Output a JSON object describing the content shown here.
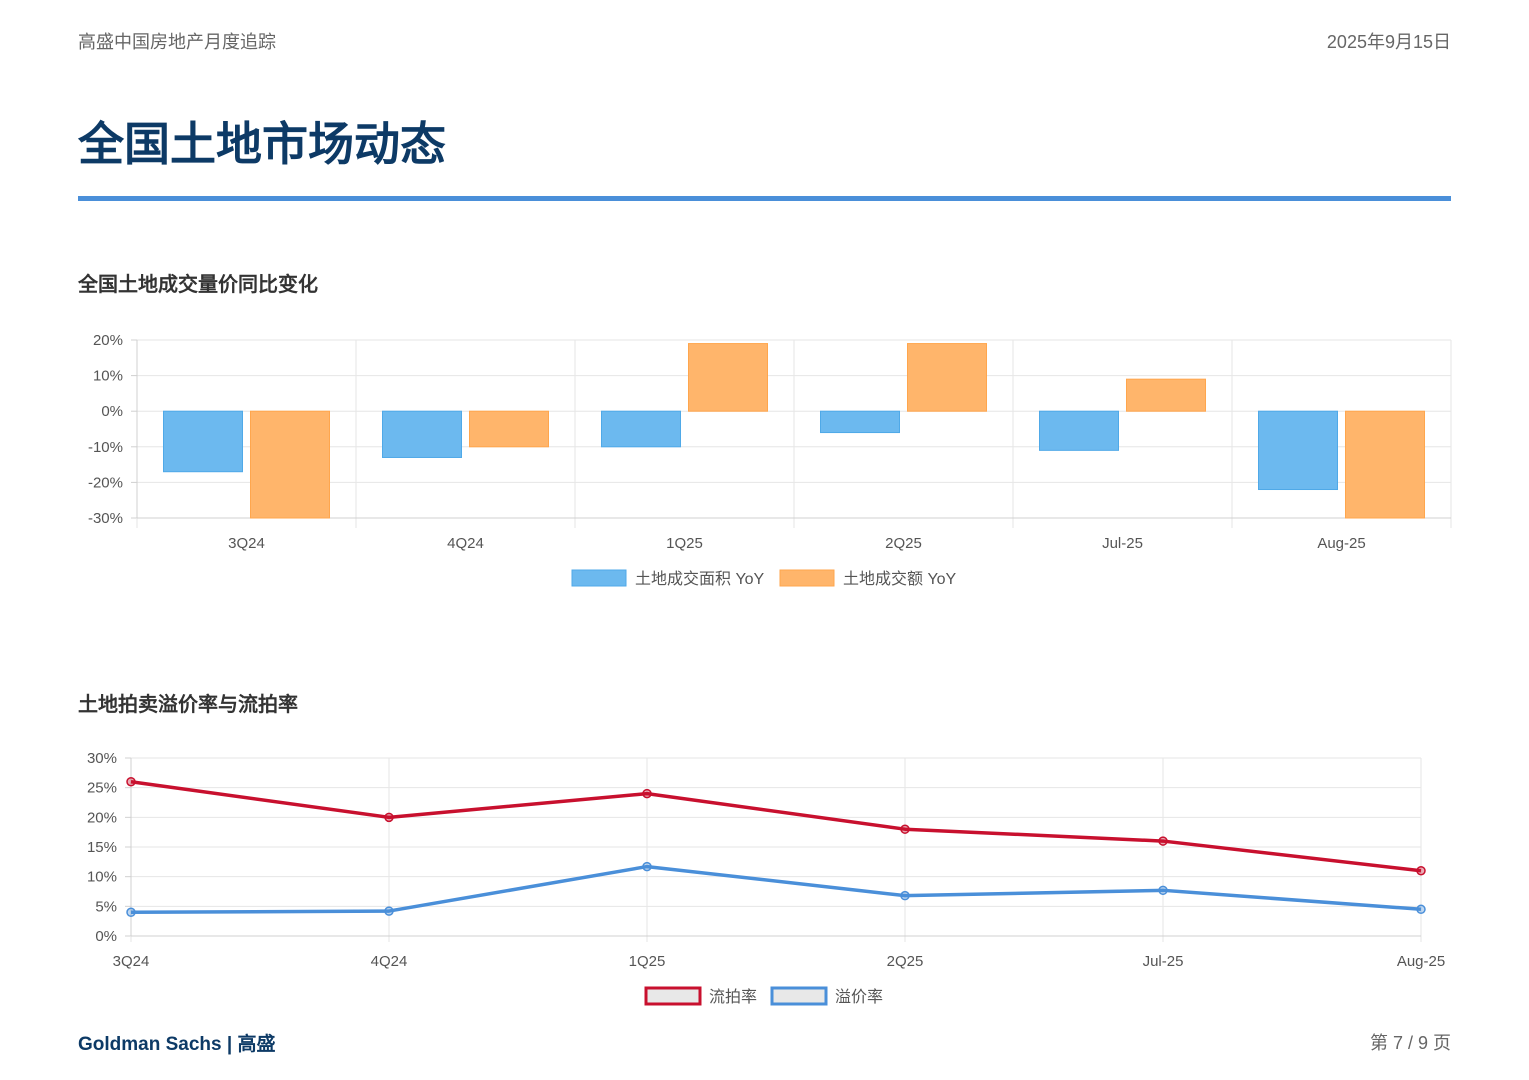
{
  "header": {
    "left": "高盛中国房地产月度追踪",
    "right": "2025年9月15日"
  },
  "page_title": "全国土地市场动态",
  "footer": {
    "left": "Goldman Sachs | 高盛",
    "right": "第 7 / 9 页"
  },
  "colors": {
    "area": "#6cb9ef",
    "value": "#ffb56b",
    "failure": "#c8102e",
    "premium": "#4a8fd9",
    "title": "#0d3a66"
  },
  "chart_data": [
    {
      "type": "bar",
      "title": "全国土地成交量价同比变化",
      "categories": [
        "3Q24",
        "4Q24",
        "1Q25",
        "2Q25",
        "Jul-25",
        "Aug-25"
      ],
      "series": [
        {
          "name": "土地成交面积 YoY",
          "values": [
            -17,
            -13,
            -10,
            -6,
            -11,
            -22
          ]
        },
        {
          "name": "土地成交额 YoY",
          "values": [
            -30,
            -10,
            19,
            19,
            9,
            -30
          ]
        }
      ],
      "ylim": [
        -30,
        20
      ],
      "yticks": [
        20,
        10,
        0,
        -10,
        -20,
        -30
      ],
      "ytick_labels": [
        "20%",
        "10%",
        "0%",
        "-10%",
        "-20%",
        "-30%"
      ],
      "grid": true,
      "legend": "bottom"
    },
    {
      "type": "line",
      "title": "土地拍卖溢价率与流拍率",
      "categories": [
        "3Q24",
        "4Q24",
        "1Q25",
        "2Q25",
        "Jul-25",
        "Aug-25"
      ],
      "series": [
        {
          "name": "流拍率",
          "values": [
            26,
            20,
            24,
            18,
            16,
            11
          ]
        },
        {
          "name": "溢价率",
          "values": [
            4.0,
            4.2,
            11.7,
            6.8,
            7.7,
            4.5
          ]
        }
      ],
      "ylim": [
        0,
        30
      ],
      "yticks": [
        30,
        25,
        20,
        15,
        10,
        5,
        0
      ],
      "ytick_labels": [
        "30%",
        "25%",
        "20%",
        "15%",
        "10%",
        "5%",
        "0%"
      ],
      "grid": true,
      "legend": "bottom"
    }
  ]
}
